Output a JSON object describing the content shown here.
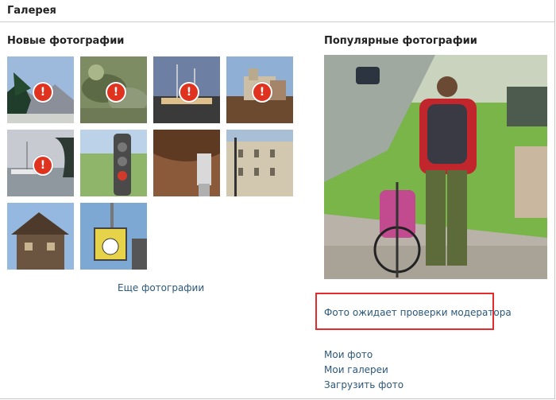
{
  "header": {
    "title": "Галерея"
  },
  "new_photos": {
    "heading": "Новые фотографии",
    "more_label": "Еще фотографии",
    "thumbnails": [
      {
        "subject": "pine-tree-mountains",
        "pending": true
      },
      {
        "subject": "rocky-garden",
        "pending": true
      },
      {
        "subject": "harbor-ship",
        "pending": true
      },
      {
        "subject": "old-town-castle",
        "pending": true
      },
      {
        "subject": "harbor-boats",
        "pending": true
      },
      {
        "subject": "traffic-light",
        "pending": false
      },
      {
        "subject": "wooden-roof-lamp",
        "pending": false
      },
      {
        "subject": "street-building",
        "pending": false
      },
      {
        "subject": "wooden-house",
        "pending": false
      },
      {
        "subject": "clock-sign",
        "pending": false
      }
    ]
  },
  "popular": {
    "heading": "Популярные фотографии",
    "photo_subject": "cyclist-walking-bike-on-path",
    "moderation_notice": "Фото ожидает проверки модератора"
  },
  "links": {
    "my_photos": "Мои фото",
    "my_galleries": "Мои галереи",
    "upload": "Загрузить фото"
  },
  "colors": {
    "link": "#2b587a",
    "warning": "#e0331f",
    "highlight_border": "#e52b2b"
  }
}
